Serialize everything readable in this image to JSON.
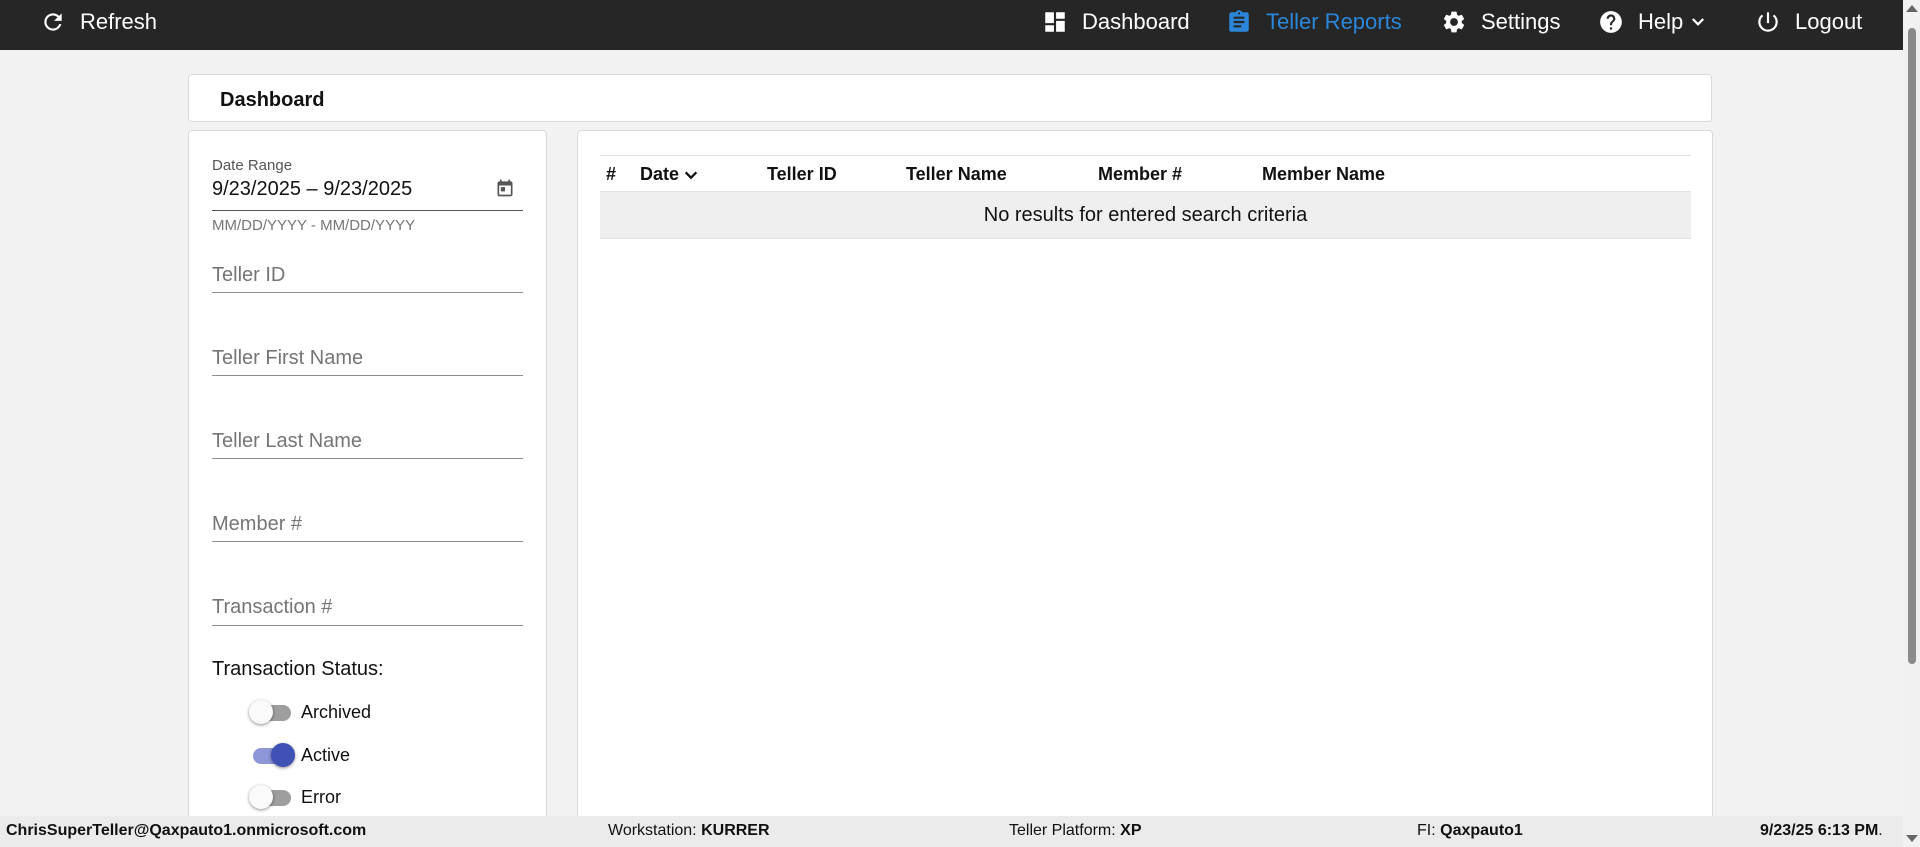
{
  "topbar": {
    "refresh_label": "Refresh",
    "nav": [
      {
        "label": "Dashboard",
        "icon": "dashboard-icon"
      },
      {
        "label": "Teller Reports",
        "icon": "clipboard-icon",
        "active": true
      },
      {
        "label": "Settings",
        "icon": "gear-icon"
      },
      {
        "label": "Help",
        "icon": "help-icon"
      },
      {
        "label": "Logout",
        "icon": "power-icon"
      }
    ],
    "active_color": "#2b86d9",
    "background": "#262626"
  },
  "page": {
    "title": "Dashboard"
  },
  "filters": {
    "date_range_label": "Date Range",
    "date_range_value": "9/23/2025 – 9/23/2025",
    "date_range_hint": "MM/DD/YYYY - MM/DD/YYYY",
    "teller_id_placeholder": "Teller ID",
    "teller_first_name_placeholder": "Teller First Name",
    "teller_last_name_placeholder": "Teller Last Name",
    "member_number_placeholder": "Member #",
    "transaction_number_placeholder": "Transaction #",
    "status_label": "Transaction Status:",
    "statuses": [
      {
        "label": "Archived",
        "on": false
      },
      {
        "label": "Active",
        "on": true
      },
      {
        "label": "Error",
        "on": false
      }
    ],
    "toggle_on_color": "#3f51b5"
  },
  "table": {
    "columns": [
      "#",
      "Date",
      "Teller ID",
      "Teller Name",
      "Member #",
      "Member Name"
    ],
    "sorted_column": "Date",
    "empty_message": "No results for entered search criteria"
  },
  "footer": {
    "user": "ChrisSuperTeller@Qaxpauto1.onmicrosoft.com",
    "workstation_label": "Workstation:",
    "workstation_value": "KURRER",
    "platform_label": "Teller Platform:",
    "platform_value": "XP",
    "fi_label": "FI:",
    "fi_value": "Qaxpauto1",
    "datetime": "9/23/25 6:13 PM",
    "datetime_suffix": "."
  }
}
